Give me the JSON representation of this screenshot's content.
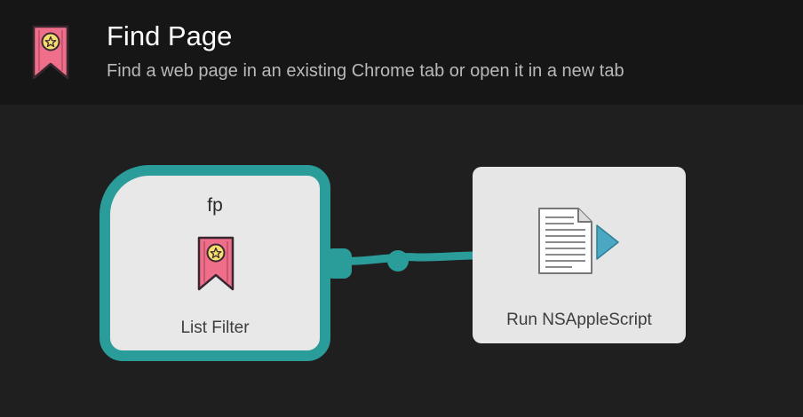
{
  "header": {
    "title": "Find Page",
    "subtitle": "Find a web page in an existing Chrome tab or open it in a new tab",
    "icon": "bookmark-star-icon"
  },
  "nodes": [
    {
      "keyword": "fp",
      "label": "List Filter",
      "icon": "bookmark-star-icon",
      "selected": true
    },
    {
      "label": "Run NSAppleScript",
      "icon": "applescript-document-icon"
    }
  ],
  "colors": {
    "background": "#1f1f1f",
    "header_background": "#161616",
    "selection_accent": "#2a9c9a",
    "bookmark_pink": "#ef6f8a",
    "star_yellow": "#f6df6e",
    "script_arrow": "#4aa8c3"
  }
}
